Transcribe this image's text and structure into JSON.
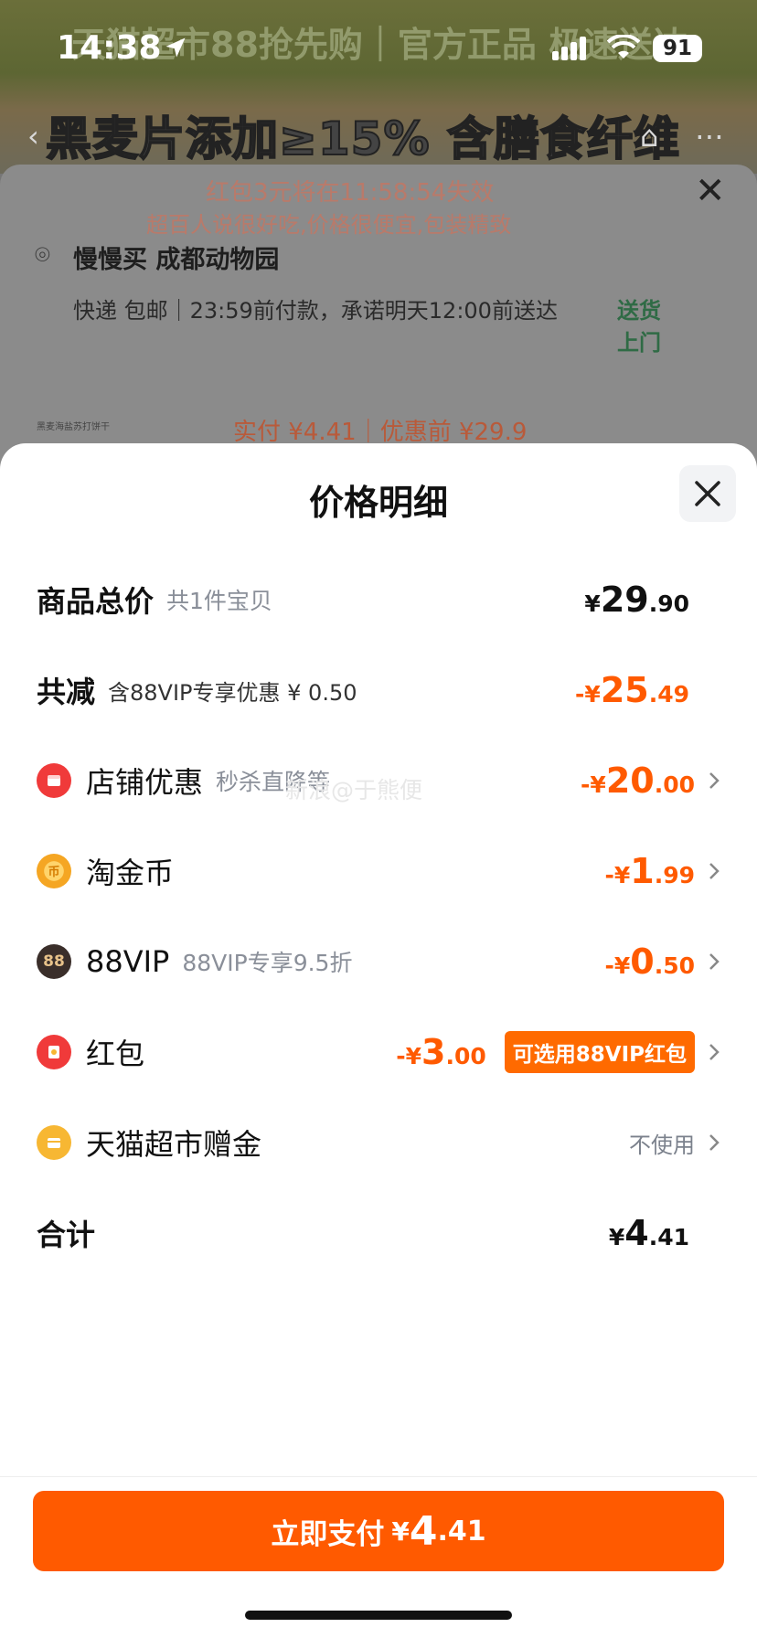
{
  "background": {
    "banner_text": "天猫超市88抢先购｜官方正品 极速送达",
    "headline": "黑麦片添加≥15% 含膳食纤维",
    "countdown": "红包3元将在11:58:54失效",
    "review_hint": "超百人说很好吃,价格很便宜,包装精致",
    "address_name": "慢慢买 成都动物园",
    "delivery_info": "快递 包邮｜23:59前付款，承诺明天12:00前送达",
    "delivery_tag": "送货上门",
    "product_thumb_text": "黑麦海盐苏打饼干",
    "price_line": "实付 ¥4.41｜优惠前 ¥29.9"
  },
  "status_bar": {
    "time": "14:38",
    "battery": "91"
  },
  "modal": {
    "title": "价格明细",
    "rows": [
      {
        "label": "商品总价",
        "sub": "共1件宝贝",
        "price": {
          "sym": "¥",
          "int": "29",
          "dec": ".90"
        }
      },
      {
        "label": "共减",
        "sub": "含88VIP专享优惠 ¥ 0.50",
        "price": {
          "sym": "-¥",
          "int": "25",
          "dec": ".49"
        }
      },
      {
        "label": "店铺优惠",
        "sub": "秒杀直降等",
        "icon": "shop-icon",
        "price": {
          "sym": "-¥",
          "int": "20",
          "dec": ".00"
        }
      },
      {
        "label": "淘金币",
        "icon": "gold-coin-icon",
        "price": {
          "sym": "-¥",
          "int": "1",
          "dec": ".99"
        }
      },
      {
        "label": "88VIP",
        "sub": "88VIP专享9.5折",
        "icon": "vip88-icon",
        "icon_text": "88",
        "price": {
          "sym": "-¥",
          "int": "0",
          "dec": ".50"
        }
      },
      {
        "label": "红包",
        "icon": "red-packet-icon",
        "price": {
          "sym": "-¥",
          "int": "3",
          "dec": ".00"
        },
        "pill": "可选用88VIP红包"
      },
      {
        "label": "天猫超市赠金",
        "icon": "gift-money-icon",
        "value_text": "不使用"
      },
      {
        "label": "合计",
        "price": {
          "sym": "¥",
          "int": "4",
          "dec": ".41"
        }
      }
    ],
    "watermark": "新浪@于熊便"
  },
  "pay_button": {
    "label": "立即支付",
    "sym": "¥",
    "int": "4",
    "dec": ".41"
  },
  "colors": {
    "accent": "#ff5a00",
    "shop_icon": "#f03a3a",
    "coin_icon": "#f5a623",
    "vip_icon": "#3a2e2a",
    "packet_icon": "#f03a3a",
    "gift_icon": "#f7b733"
  }
}
